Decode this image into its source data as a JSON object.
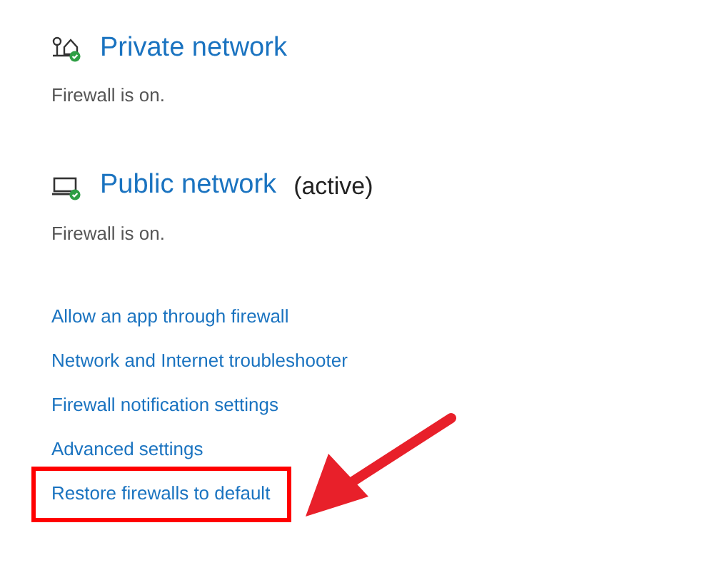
{
  "networks": [
    {
      "kind": "private",
      "name": "Private network",
      "status": "Firewall is on."
    },
    {
      "kind": "public",
      "name": "Public network",
      "suffix": "(active)",
      "status": "Firewall is on."
    }
  ],
  "links": [
    {
      "label": "Allow an app through firewall",
      "highlighted": false
    },
    {
      "label": "Network and Internet troubleshooter",
      "highlighted": false
    },
    {
      "label": "Firewall notification settings",
      "highlighted": false
    },
    {
      "label": "Advanced settings",
      "highlighted": false
    },
    {
      "label": "Restore firewalls to default",
      "highlighted": true
    }
  ]
}
